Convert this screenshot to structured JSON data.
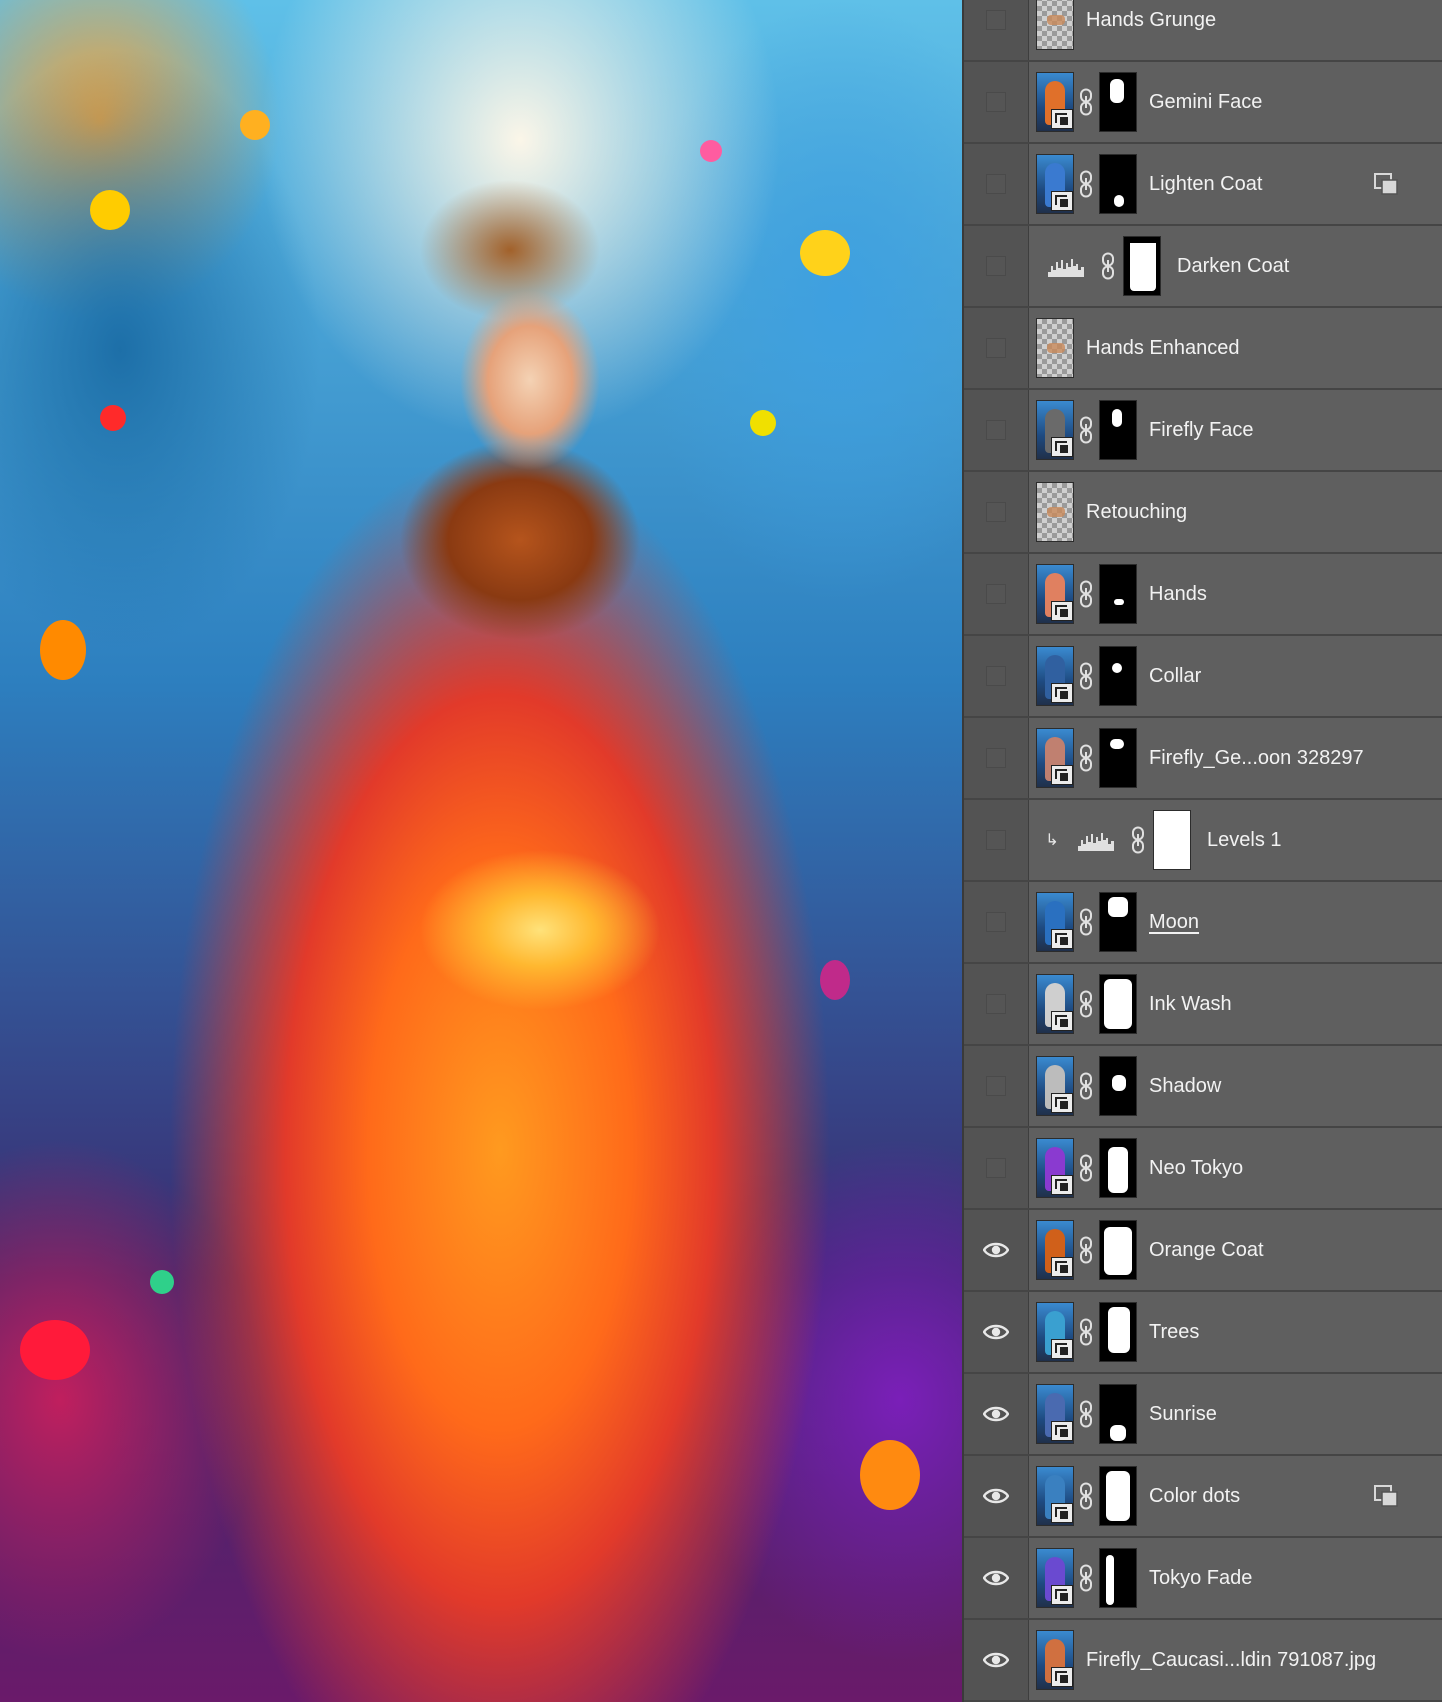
{
  "layers": [
    {
      "name": "Hands Grunge",
      "visible": false
    },
    {
      "name": "Gemini Face",
      "visible": false
    },
    {
      "name": "Lighten Coat",
      "visible": false
    },
    {
      "name": "Darken Coat",
      "visible": false
    },
    {
      "name": "Hands Enhanced",
      "visible": false
    },
    {
      "name": "Firefly Face",
      "visible": false
    },
    {
      "name": "Retouching",
      "visible": false
    },
    {
      "name": "Hands",
      "visible": false
    },
    {
      "name": "Collar",
      "visible": false
    },
    {
      "name": "Firefly_Ge...oon 328297",
      "visible": false
    },
    {
      "name": "Levels 1",
      "visible": false
    },
    {
      "name": "Moon",
      "visible": false
    },
    {
      "name": "Ink Wash",
      "visible": false
    },
    {
      "name": "Shadow",
      "visible": false
    },
    {
      "name": "Neo Tokyo",
      "visible": false
    },
    {
      "name": "Orange Coat",
      "visible": true
    },
    {
      "name": "Trees",
      "visible": true
    },
    {
      "name": "Sunrise",
      "visible": true
    },
    {
      "name": "Color dots",
      "visible": true
    },
    {
      "name": "Tokyo Fade",
      "visible": true
    },
    {
      "name": "Firefly_Caucasi...ldin 791087.jpg",
      "visible": true
    }
  ],
  "colors": {
    "panel_bg": "#535353",
    "row_bg": "#5f5f5f",
    "text": "#f2f2f2"
  }
}
